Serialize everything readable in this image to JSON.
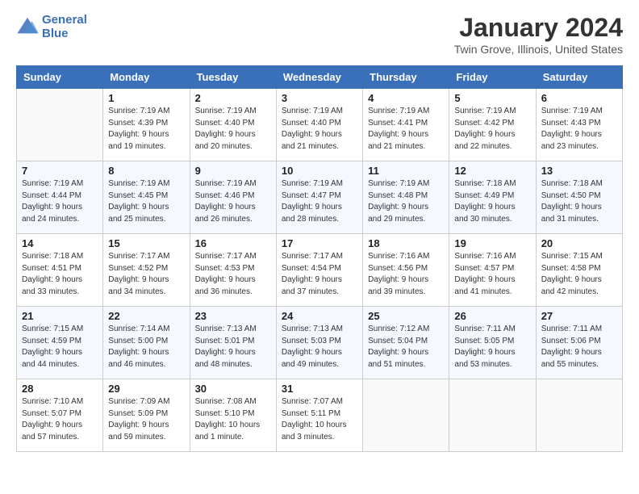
{
  "header": {
    "logo_line1": "General",
    "logo_line2": "Blue",
    "main_title": "January 2024",
    "subtitle": "Twin Grove, Illinois, United States"
  },
  "days_of_week": [
    "Sunday",
    "Monday",
    "Tuesday",
    "Wednesday",
    "Thursday",
    "Friday",
    "Saturday"
  ],
  "weeks": [
    [
      {
        "num": "",
        "info": ""
      },
      {
        "num": "1",
        "info": "Sunrise: 7:19 AM\nSunset: 4:39 PM\nDaylight: 9 hours\nand 19 minutes."
      },
      {
        "num": "2",
        "info": "Sunrise: 7:19 AM\nSunset: 4:40 PM\nDaylight: 9 hours\nand 20 minutes."
      },
      {
        "num": "3",
        "info": "Sunrise: 7:19 AM\nSunset: 4:40 PM\nDaylight: 9 hours\nand 21 minutes."
      },
      {
        "num": "4",
        "info": "Sunrise: 7:19 AM\nSunset: 4:41 PM\nDaylight: 9 hours\nand 21 minutes."
      },
      {
        "num": "5",
        "info": "Sunrise: 7:19 AM\nSunset: 4:42 PM\nDaylight: 9 hours\nand 22 minutes."
      },
      {
        "num": "6",
        "info": "Sunrise: 7:19 AM\nSunset: 4:43 PM\nDaylight: 9 hours\nand 23 minutes."
      }
    ],
    [
      {
        "num": "7",
        "info": "Sunrise: 7:19 AM\nSunset: 4:44 PM\nDaylight: 9 hours\nand 24 minutes."
      },
      {
        "num": "8",
        "info": "Sunrise: 7:19 AM\nSunset: 4:45 PM\nDaylight: 9 hours\nand 25 minutes."
      },
      {
        "num": "9",
        "info": "Sunrise: 7:19 AM\nSunset: 4:46 PM\nDaylight: 9 hours\nand 26 minutes."
      },
      {
        "num": "10",
        "info": "Sunrise: 7:19 AM\nSunset: 4:47 PM\nDaylight: 9 hours\nand 28 minutes."
      },
      {
        "num": "11",
        "info": "Sunrise: 7:19 AM\nSunset: 4:48 PM\nDaylight: 9 hours\nand 29 minutes."
      },
      {
        "num": "12",
        "info": "Sunrise: 7:18 AM\nSunset: 4:49 PM\nDaylight: 9 hours\nand 30 minutes."
      },
      {
        "num": "13",
        "info": "Sunrise: 7:18 AM\nSunset: 4:50 PM\nDaylight: 9 hours\nand 31 minutes."
      }
    ],
    [
      {
        "num": "14",
        "info": "Sunrise: 7:18 AM\nSunset: 4:51 PM\nDaylight: 9 hours\nand 33 minutes."
      },
      {
        "num": "15",
        "info": "Sunrise: 7:17 AM\nSunset: 4:52 PM\nDaylight: 9 hours\nand 34 minutes."
      },
      {
        "num": "16",
        "info": "Sunrise: 7:17 AM\nSunset: 4:53 PM\nDaylight: 9 hours\nand 36 minutes."
      },
      {
        "num": "17",
        "info": "Sunrise: 7:17 AM\nSunset: 4:54 PM\nDaylight: 9 hours\nand 37 minutes."
      },
      {
        "num": "18",
        "info": "Sunrise: 7:16 AM\nSunset: 4:56 PM\nDaylight: 9 hours\nand 39 minutes."
      },
      {
        "num": "19",
        "info": "Sunrise: 7:16 AM\nSunset: 4:57 PM\nDaylight: 9 hours\nand 41 minutes."
      },
      {
        "num": "20",
        "info": "Sunrise: 7:15 AM\nSunset: 4:58 PM\nDaylight: 9 hours\nand 42 minutes."
      }
    ],
    [
      {
        "num": "21",
        "info": "Sunrise: 7:15 AM\nSunset: 4:59 PM\nDaylight: 9 hours\nand 44 minutes."
      },
      {
        "num": "22",
        "info": "Sunrise: 7:14 AM\nSunset: 5:00 PM\nDaylight: 9 hours\nand 46 minutes."
      },
      {
        "num": "23",
        "info": "Sunrise: 7:13 AM\nSunset: 5:01 PM\nDaylight: 9 hours\nand 48 minutes."
      },
      {
        "num": "24",
        "info": "Sunrise: 7:13 AM\nSunset: 5:03 PM\nDaylight: 9 hours\nand 49 minutes."
      },
      {
        "num": "25",
        "info": "Sunrise: 7:12 AM\nSunset: 5:04 PM\nDaylight: 9 hours\nand 51 minutes."
      },
      {
        "num": "26",
        "info": "Sunrise: 7:11 AM\nSunset: 5:05 PM\nDaylight: 9 hours\nand 53 minutes."
      },
      {
        "num": "27",
        "info": "Sunrise: 7:11 AM\nSunset: 5:06 PM\nDaylight: 9 hours\nand 55 minutes."
      }
    ],
    [
      {
        "num": "28",
        "info": "Sunrise: 7:10 AM\nSunset: 5:07 PM\nDaylight: 9 hours\nand 57 minutes."
      },
      {
        "num": "29",
        "info": "Sunrise: 7:09 AM\nSunset: 5:09 PM\nDaylight: 9 hours\nand 59 minutes."
      },
      {
        "num": "30",
        "info": "Sunrise: 7:08 AM\nSunset: 5:10 PM\nDaylight: 10 hours\nand 1 minute."
      },
      {
        "num": "31",
        "info": "Sunrise: 7:07 AM\nSunset: 5:11 PM\nDaylight: 10 hours\nand 3 minutes."
      },
      {
        "num": "",
        "info": ""
      },
      {
        "num": "",
        "info": ""
      },
      {
        "num": "",
        "info": ""
      }
    ]
  ]
}
